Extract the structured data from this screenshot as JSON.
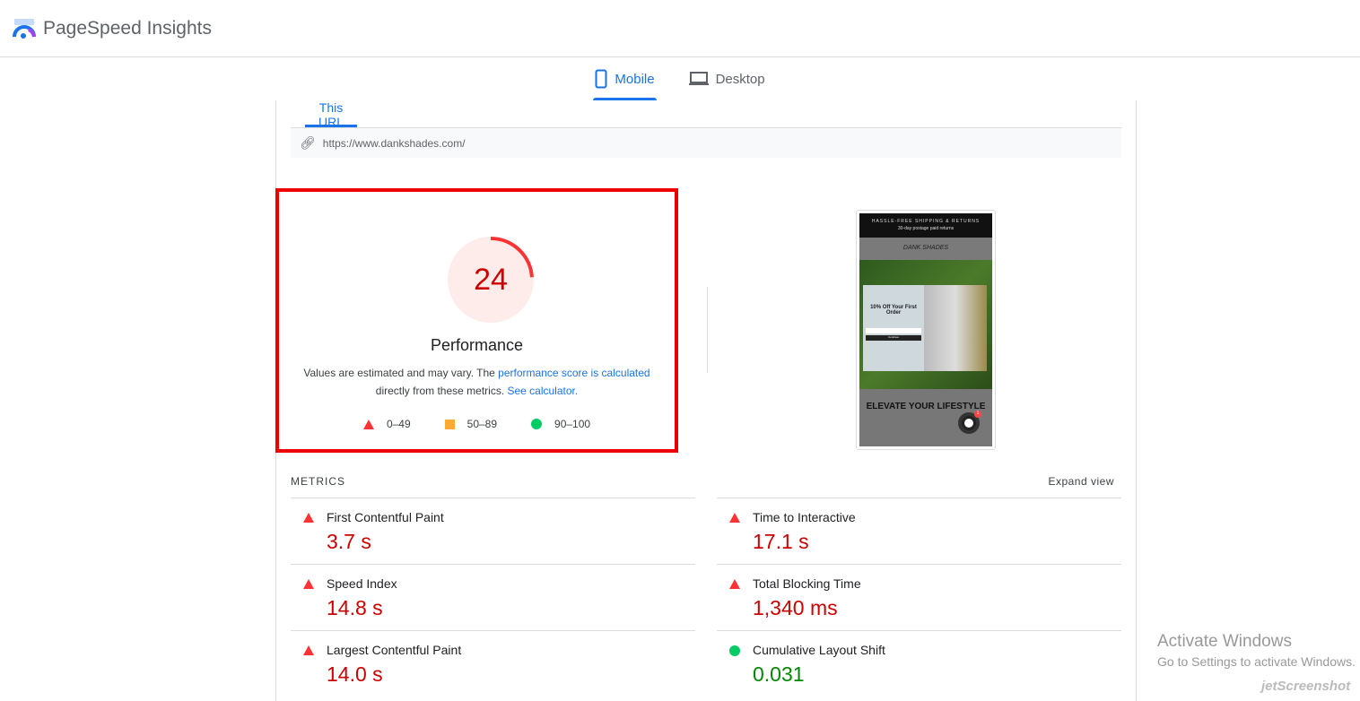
{
  "app": {
    "title": "PageSpeed Insights"
  },
  "device_tabs": [
    {
      "label": "Mobile",
      "active": true
    },
    {
      "label": "Desktop",
      "active": false
    }
  ],
  "url_tab": "This URL",
  "url": "https://www.dankshades.com/",
  "score": {
    "value": 24,
    "label": "Performance",
    "color": "#cc0000"
  },
  "description": {
    "prefix": "Values are estimated and may vary. The ",
    "link1": "performance score is calculated",
    "middle": " directly from these metrics. ",
    "link2": "See calculator."
  },
  "legend": [
    {
      "range": "0–49",
      "icon": "red-triangle"
    },
    {
      "range": "50–89",
      "icon": "orange-square"
    },
    {
      "range": "90–100",
      "icon": "green-circle"
    }
  ],
  "screenshot": {
    "banner1": "HASSLE-FREE SHIPPING & RETURNS",
    "banner2": "30-day postage paid returns",
    "logo": "DANK SHADES",
    "popup_title": "10% Off Your First Order",
    "popup_button": "Continue",
    "headline": "ELEVATE YOUR LIFESTYLE",
    "chat_badge": "1"
  },
  "metrics": {
    "heading": "METRICS",
    "expand": "Expand view",
    "items": [
      {
        "label": "First Contentful Paint",
        "value": "3.7 s",
        "status": "poor"
      },
      {
        "label": "Time to Interactive",
        "value": "17.1 s",
        "status": "poor"
      },
      {
        "label": "Speed Index",
        "value": "14.8 s",
        "status": "poor"
      },
      {
        "label": "Total Blocking Time",
        "value": "1,340 ms",
        "status": "poor"
      },
      {
        "label": "Largest Contentful Paint",
        "value": "14.0 s",
        "status": "poor"
      },
      {
        "label": "Cumulative Layout Shift",
        "value": "0.031",
        "status": "good"
      }
    ]
  },
  "watermark": {
    "line1": "Activate Windows",
    "line2": "Go to Settings to activate Windows.",
    "brand": "jetScreenshot"
  }
}
